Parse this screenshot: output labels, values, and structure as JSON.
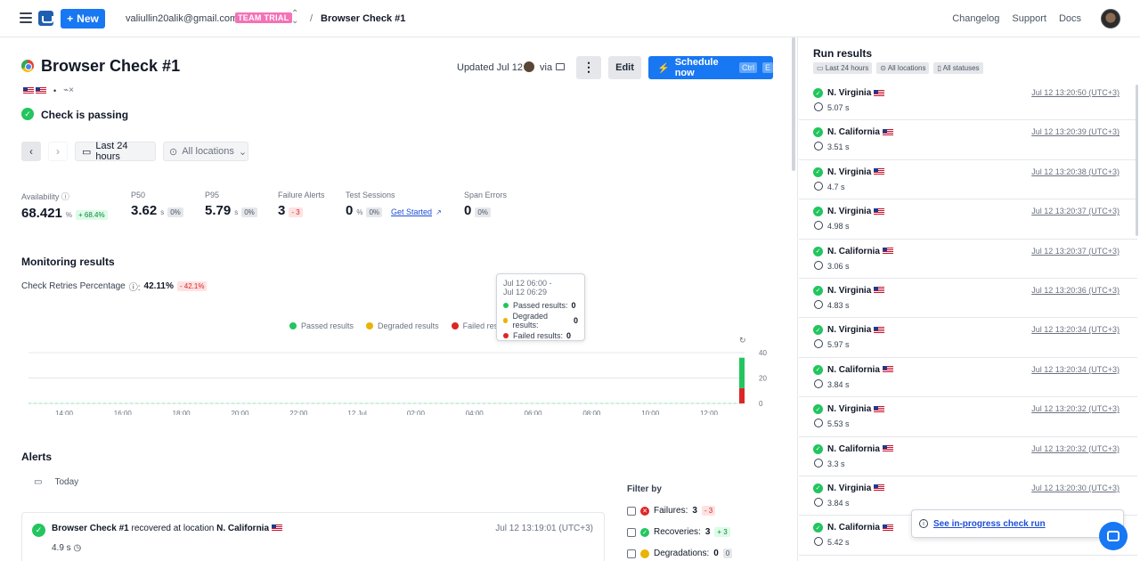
{
  "topbar": {
    "new_label": "New",
    "email": "valiullin20alik@gmail.com",
    "team_badge": "TEAM TRIAL",
    "separator": "/",
    "breadcrumb": "Browser Check #1",
    "links": [
      "Changelog",
      "Support",
      "Docs"
    ]
  },
  "check": {
    "title": "Browser Check #1",
    "status": "Check is passing",
    "updated": "Updated Jul 12",
    "via": "via",
    "edit_label": "Edit",
    "schedule_label": "Schedule now",
    "kbd_ctrl": "Ctrl",
    "kbd_key": "E"
  },
  "filters": {
    "range": "Last 24 hours",
    "locations": "All locations"
  },
  "stats": {
    "availability": {
      "label": "Availability",
      "value": "68.421",
      "unit": "%",
      "delta": "+ 68.4%"
    },
    "p50": {
      "label": "P50",
      "value": "3.62",
      "unit": "s",
      "delta": "0%"
    },
    "p95": {
      "label": "P95",
      "value": "5.79",
      "unit": "s",
      "delta": "0%"
    },
    "failure_alerts": {
      "label": "Failure Alerts",
      "value": "3",
      "delta": "- 3"
    },
    "test_sessions": {
      "label": "Test Sessions",
      "value": "0",
      "unit": "%",
      "delta": "0%",
      "link": "Get Started"
    },
    "span_errors": {
      "label": "Span Errors",
      "value": "0",
      "delta": "0%"
    }
  },
  "monitoring": {
    "title": "Monitoring results",
    "retries_label": "Check Retries Percentage",
    "retries_value": "42.11%",
    "retries_delta": "- 42.1%",
    "legend": [
      "Passed results",
      "Degraded results",
      "Failed resu"
    ],
    "tooltip": {
      "line1": "Jul 12 06:00 -",
      "line2": "Jul 12 06:29",
      "passed_label": "Passed results:",
      "passed": "0",
      "degraded_label": "Degraded results:",
      "degraded": "0",
      "failed_label": "Failed results:",
      "failed": "0"
    }
  },
  "chart_data": {
    "type": "bar",
    "categories": [
      "14:00",
      "16:00",
      "18:00",
      "20:00",
      "22:00",
      "12 Jul",
      "02:00",
      "04:00",
      "06:00",
      "08:00",
      "10:00",
      "12:00"
    ],
    "series": [
      {
        "name": "Passed results",
        "values": [
          0,
          0,
          0,
          0,
          0,
          0,
          0,
          0,
          0,
          0,
          0,
          24
        ],
        "color": "#22c55e"
      },
      {
        "name": "Degraded results",
        "values": [
          0,
          0,
          0,
          0,
          0,
          0,
          0,
          0,
          0,
          0,
          0,
          0
        ],
        "color": "#eab308"
      },
      {
        "name": "Failed results",
        "values": [
          0,
          0,
          0,
          0,
          0,
          0,
          0,
          0,
          0,
          0,
          0,
          12
        ],
        "color": "#dc2626"
      }
    ],
    "yticks": [
      "40",
      "20",
      "0"
    ],
    "ylim": [
      0,
      40
    ]
  },
  "alerts": {
    "title": "Alerts",
    "today": "Today",
    "filter_title": "Filter by",
    "filters": [
      {
        "label": "Failures:",
        "count": "3",
        "delta": "- 3"
      },
      {
        "label": "Recoveries:",
        "count": "3",
        "delta": "+ 3"
      },
      {
        "label": "Degradations:",
        "count": "0",
        "delta": "0"
      }
    ],
    "item": {
      "check": "Browser Check #1",
      "text": "recovered at location",
      "location": "N. California",
      "time": "Jul 12 13:19:01 (UTC+3)",
      "duration": "4.9 s"
    }
  },
  "run_results": {
    "title": "Run results",
    "chips": [
      "Last 24 hours",
      "All locations",
      "All statuses"
    ],
    "runs": [
      {
        "location": "N. Virginia",
        "time": "Jul 12 13:20:50 (UTC+3)",
        "duration": "5.07 s"
      },
      {
        "location": "N. California",
        "time": "Jul 12 13:20:39 (UTC+3)",
        "duration": "3.51 s"
      },
      {
        "location": "N. Virginia",
        "time": "Jul 12 13:20:38 (UTC+3)",
        "duration": "4.7 s"
      },
      {
        "location": "N. Virginia",
        "time": "Jul 12 13:20:37 (UTC+3)",
        "duration": "4.98 s"
      },
      {
        "location": "N. California",
        "time": "Jul 12 13:20:37 (UTC+3)",
        "duration": "3.06 s"
      },
      {
        "location": "N. Virginia",
        "time": "Jul 12 13:20:36 (UTC+3)",
        "duration": "4.83 s"
      },
      {
        "location": "N. Virginia",
        "time": "Jul 12 13:20:34 (UTC+3)",
        "duration": "5.97 s"
      },
      {
        "location": "N. California",
        "time": "Jul 12 13:20:34 (UTC+3)",
        "duration": "3.84 s"
      },
      {
        "location": "N. Virginia",
        "time": "Jul 12 13:20:32 (UTC+3)",
        "duration": "5.53 s"
      },
      {
        "location": "N. California",
        "time": "Jul 12 13:20:32 (UTC+3)",
        "duration": "3.3 s"
      },
      {
        "location": "N. Virginia",
        "time": "Jul 12 13:20:30 (UTC+3)",
        "duration": "3.84 s"
      },
      {
        "location": "N. California",
        "time": "",
        "duration": "5.42 s"
      }
    ],
    "in_progress": "See in-progress check run"
  },
  "colors": {
    "primary": "#1877f2",
    "success": "#22c55e",
    "failure": "#dc2626",
    "degraded": "#eab308",
    "team_badge": "#f472b6"
  }
}
